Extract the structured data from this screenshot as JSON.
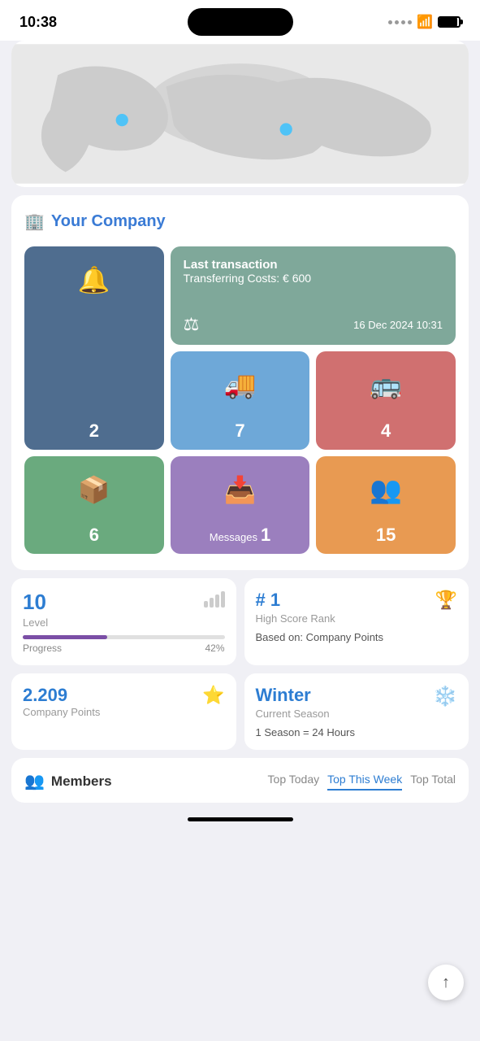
{
  "statusBar": {
    "time": "10:38"
  },
  "company": {
    "name": "Your Company",
    "iconSymbol": "🏢"
  },
  "tiles": [
    {
      "id": "notifications",
      "icon": "🔔",
      "value": "2",
      "color": "tile-blue",
      "label": ""
    },
    {
      "id": "inventory",
      "icon": "📦",
      "value": "6",
      "color": "tile-green",
      "label": ""
    },
    {
      "id": "messages",
      "icon": "📥",
      "value": "1",
      "color": "tile-purple",
      "label": "Messages"
    }
  ],
  "transaction": {
    "title": "Last transaction",
    "description": "Transferring Costs: € 600",
    "date": "16 Dec 2024 10:31",
    "iconSymbol": "⚖"
  },
  "bottomTiles": [
    {
      "id": "trucks",
      "icon": "🚚",
      "value": "7",
      "color": "tile-light-blue"
    },
    {
      "id": "transport",
      "icon": "🚌",
      "value": "4",
      "color": "tile-pink"
    },
    {
      "id": "people",
      "icon": "👥",
      "value": "15",
      "color": "tile-orange"
    }
  ],
  "levelCard": {
    "level": "10",
    "levelLabel": "Level",
    "progressLabel": "Progress",
    "progressPct": "42%",
    "progressWidth": 42
  },
  "rankCard": {
    "rank": "# 1",
    "rankLabel": "High Score Rank",
    "basedOn": "Based on: Company Points"
  },
  "pointsCard": {
    "points": "2.209",
    "pointsLabel": "Company Points"
  },
  "seasonCard": {
    "season": "Winter",
    "seasonLabel": "Current Season",
    "seasonInfo": "1 Season = 24 Hours"
  },
  "members": {
    "title": "Members",
    "tabs": [
      {
        "id": "top-today",
        "label": "Top Today",
        "active": false
      },
      {
        "id": "top-week",
        "label": "Top This Week",
        "active": true
      },
      {
        "id": "top-total",
        "label": "Top Total",
        "active": false
      }
    ]
  },
  "fab": {
    "icon": "↑"
  }
}
